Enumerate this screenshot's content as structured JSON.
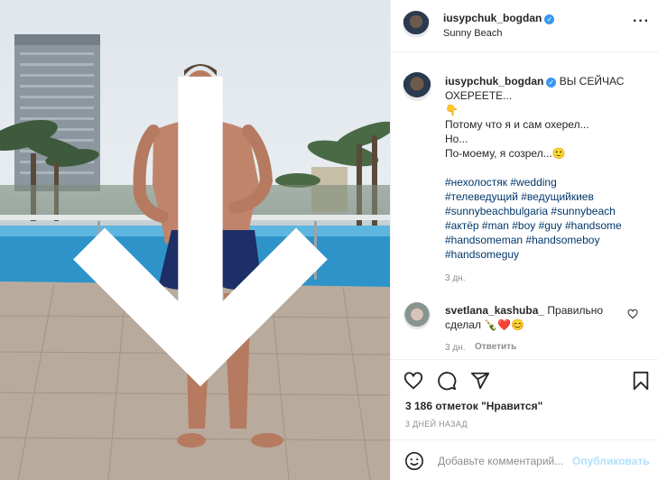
{
  "post": {
    "username": "iusypchuk_bogdan",
    "location": "Sunny Beach",
    "caption_lines": [
      "ВЫ СЕЙЧАС",
      "ОХЕРЕЕТЕ...",
      "👇",
      "Потому что я и сам охерел...",
      "Но...",
      "По-моему, я созрел...🙂"
    ],
    "hashtag_lines": [
      "#нехолостяк #wedding",
      "#телеведущий #ведущийкиев",
      "#sunnybeachbulgaria #sunnybeach",
      "#актёр #man #boy #guy #handsome",
      "#handsomeman #handsomeboy",
      "#handsomeguy"
    ],
    "caption_age": "3 дн."
  },
  "comment": {
    "username": "svetlana_kashuba_",
    "text": "Правильно сделал 🍾❤️😊",
    "age": "3 дн.",
    "reply_label": "Ответить"
  },
  "actions": {
    "likes_count": "3 186",
    "likes_text": "отметок \"Нравится\"",
    "date": "3 ДНЕЙ НАЗАД"
  },
  "add_comment": {
    "placeholder": "Добавьте комментарий...",
    "publish_label": "Опубликовать"
  },
  "icons": {
    "like": "heart-icon",
    "comment": "comment-icon",
    "share": "paper-plane-icon",
    "save": "bookmark-icon",
    "emoji": "smiley-icon",
    "download": "arrow-down-icon"
  },
  "colors": {
    "verified": "#3897f0",
    "hashtag": "#00376b",
    "publish": "#b2dffc",
    "muted": "#8e8e8e"
  }
}
